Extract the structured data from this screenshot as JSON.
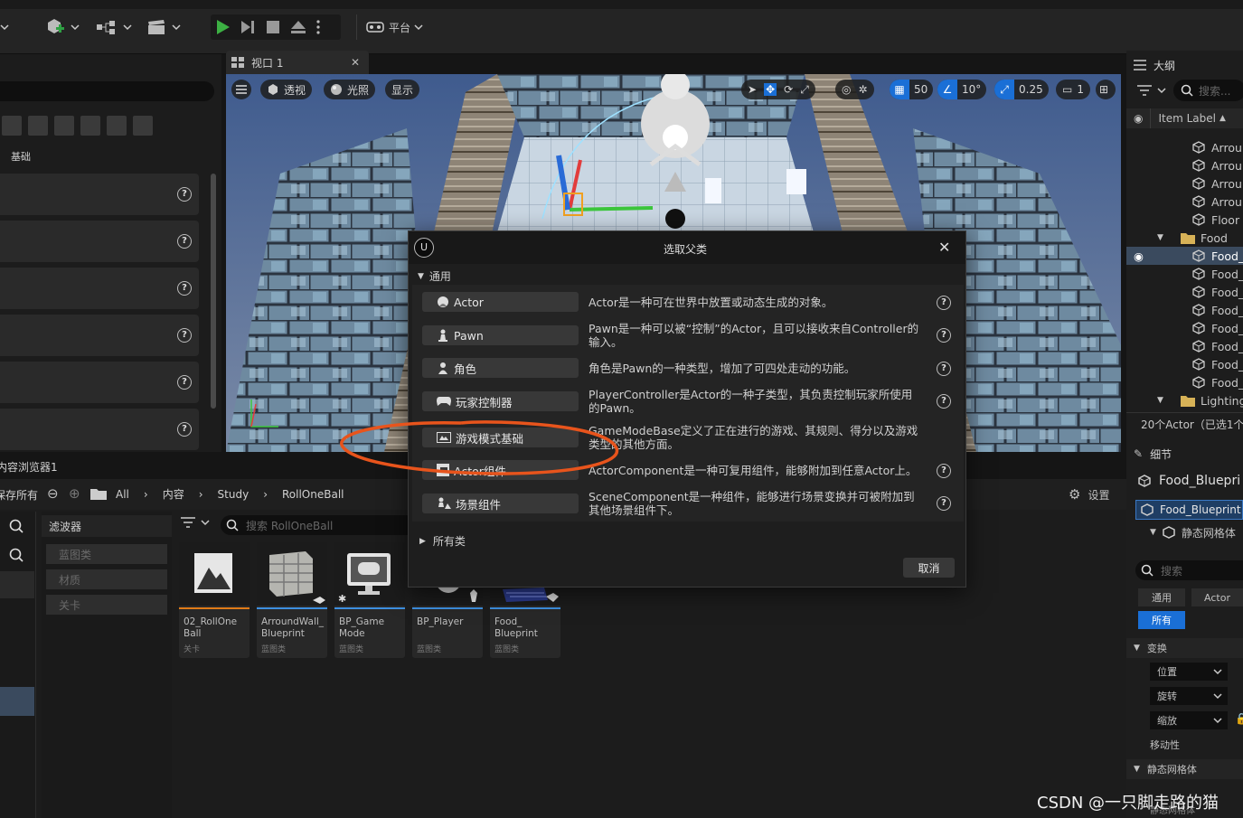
{
  "toolbar": {
    "platform_label": "平台"
  },
  "viewport": {
    "tab_label": "视口 1",
    "perspective_label": "透视",
    "lighting_label": "光照",
    "show_label": "显示",
    "grid_value": "50",
    "rotation_value": "10°",
    "scale_value": "0.25",
    "camera_value": "1"
  },
  "left_panel": {
    "section_label": "基础"
  },
  "outliner": {
    "title": "大纲",
    "search_placeholder": "搜索...",
    "column_label": "Item Label",
    "items": [
      {
        "label": "Arroun"
      },
      {
        "label": "Arroun"
      },
      {
        "label": "Arroun"
      },
      {
        "label": "Arroun"
      },
      {
        "label": "Floor"
      },
      {
        "label": "Food"
      },
      {
        "label": "Food_"
      },
      {
        "label": "Food_"
      },
      {
        "label": "Food_"
      },
      {
        "label": "Food_"
      },
      {
        "label": "Food_"
      },
      {
        "label": "Food_"
      },
      {
        "label": "Food_"
      },
      {
        "label": "Food_"
      },
      {
        "label": "Lighting"
      }
    ],
    "status": "20个Actor（已选1个"
  },
  "details": {
    "title": "细节",
    "object_name": "Food_Bluepri",
    "component_root": "Food_Blueprint",
    "component_child": "静态网格体",
    "search_placeholder": "搜索",
    "filter_general": "通用",
    "filter_actor": "Actor",
    "filter_all": "所有",
    "section_transform": "变换",
    "position": "位置",
    "rotation": "旋转",
    "scale": "缩放",
    "mobility": "移动性",
    "section_mesh": "静态网格体",
    "mesh_sub": "静态网格体"
  },
  "content_browser": {
    "tab_label": "内容浏览器1",
    "save_all": "保存所有",
    "crumb_all": "All",
    "crumb_content": "内容",
    "crumb_study": "Study",
    "crumb_rollone": "RollOneBall",
    "settings_label": "设置",
    "filters_title": "滤波器",
    "filters": [
      "蓝图类",
      "材质",
      "关卡"
    ],
    "search_placeholder": "搜索 RollOneBall",
    "assets": [
      {
        "name": "02_RollOne Ball",
        "type": "关卡",
        "bar": "#e07b18"
      },
      {
        "name": "ArroundWall_ Blueprint",
        "type": "蓝图类",
        "bar": "#3d8fe0"
      },
      {
        "name": "BP_Game Mode",
        "type": "蓝图类",
        "bar": "#3d8fe0"
      },
      {
        "name": "BP_Player",
        "type": "蓝图类",
        "bar": "#3d8fe0"
      },
      {
        "name": "Food_ Blueprint",
        "type": "蓝图类",
        "bar": "#3d8fe0"
      }
    ]
  },
  "dialog": {
    "title": "选取父类",
    "section_common": "通用",
    "classes": [
      {
        "label": "Actor",
        "desc": "Actor是一种可在世界中放置或动态生成的对象。"
      },
      {
        "label": "Pawn",
        "desc": "Pawn是一种可以被“控制”的Actor，且可以接收来自Controller的输入。"
      },
      {
        "label": "角色",
        "desc": "角色是Pawn的一种类型，增加了可四处走动的功能。"
      },
      {
        "label": "玩家控制器",
        "desc": "PlayerController是Actor的一种子类型，其负责控制玩家所使用的Pawn。"
      },
      {
        "label": "游戏模式基础",
        "desc": "GameModeBase定义了正在进行的游戏、其规则、得分以及游戏类型的其他方面。"
      },
      {
        "label": "Actor组件",
        "desc": "ActorComponent是一种可复用组件，能够附加到任意Actor上。"
      },
      {
        "label": "场景组件",
        "desc": "SceneComponent是一种组件，能够进行场景变换并可被附加到其他场景组件下。"
      }
    ],
    "section_all": "所有类",
    "cancel_label": "取消"
  },
  "watermark": "CSDN @一只脚走路的猫",
  "colors": {
    "accent_blue": "#1a6fd6",
    "annotation_orange": "#e8541c",
    "level_bar": "#e07b18",
    "blueprint_bar": "#3d8fe0"
  }
}
